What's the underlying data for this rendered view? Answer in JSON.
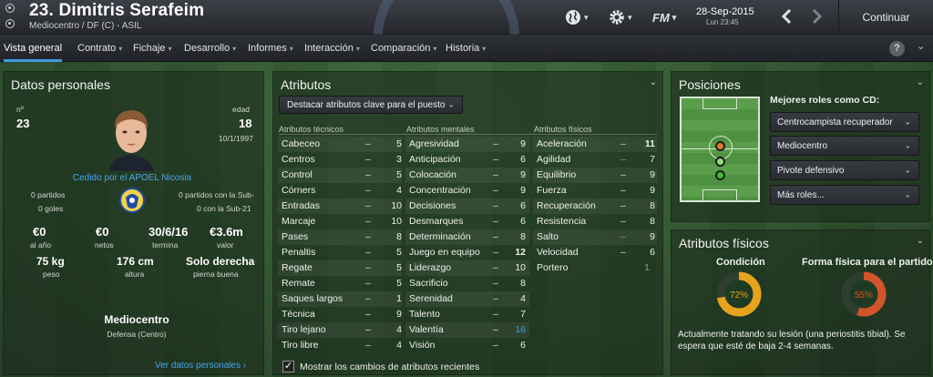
{
  "header": {
    "player_title": "23. Dimitris Serafeim",
    "subtitle": "Mediocentro / DF (C) - ASIL",
    "date": "28-Sep-2015",
    "time": "Lun 23:45",
    "fm_label": "FM",
    "continue_label": "Continuar"
  },
  "nav": {
    "items": [
      {
        "label": "Vista general",
        "chev": ""
      },
      {
        "label": "Contrato",
        "chev": "▾"
      },
      {
        "label": "Fichaje",
        "chev": "▾"
      },
      {
        "label": "Desarrollo",
        "chev": "▾"
      },
      {
        "label": "Informes",
        "chev": "▾"
      },
      {
        "label": "Interacción",
        "chev": "▾"
      },
      {
        "label": "Comparación",
        "chev": "▾"
      },
      {
        "label": "Historia",
        "chev": "▾"
      }
    ],
    "help": "?"
  },
  "personal": {
    "title": "Datos personales",
    "number_label": "nº",
    "number": "23",
    "age_label": "edad",
    "age": "18",
    "dob": "10/1/1997",
    "loan_text": "Cedido por el APOEL Nicosia",
    "matches_left": "0 partidos",
    "goals_left": "0 goles",
    "matches_right": "0 partidos con la Sub-",
    "goals_right": "0 con la Sub-21",
    "wage": "€0",
    "wage_label": "al año",
    "net": "€0",
    "net_label": "netos",
    "contract_end": "30/6/16",
    "contract_label": "termina",
    "value": "€3.6m",
    "value_label": "valor",
    "weight": "75 kg",
    "weight_label": "peso",
    "height": "176 cm",
    "height_label": "altura",
    "foot": "Solo derecha",
    "foot_label": "pierna buena",
    "position": "Mediocentro",
    "position_detail": "Defensa (Centro)",
    "more_link": "Ver datos personales ›"
  },
  "attributes": {
    "title": "Atributos",
    "highlight_dropdown": "Destacar atributos clave para el puesto",
    "technical_header": "Atributos técnicos",
    "mental_header": "Atributos mentales",
    "physical_header": "Atributos físicos",
    "technical": [
      {
        "name": "Cabeceo",
        "dash": "–",
        "value": "5"
      },
      {
        "name": "Centros",
        "dash": "–",
        "value": "3"
      },
      {
        "name": "Control",
        "dash": "–",
        "value": "5"
      },
      {
        "name": "Córners",
        "dash": "–",
        "value": "4"
      },
      {
        "name": "Entradas",
        "dash": "–",
        "value": "10"
      },
      {
        "name": "Marcaje",
        "dash": "–",
        "value": "10"
      },
      {
        "name": "Pases",
        "dash": "–",
        "value": "8"
      },
      {
        "name": "Penaltis",
        "dash": "–",
        "value": "5"
      },
      {
        "name": "Regate",
        "dash": "–",
        "value": "5"
      },
      {
        "name": "Remate",
        "dash": "–",
        "value": "5"
      },
      {
        "name": "Saques largos",
        "dash": "–",
        "value": "1"
      },
      {
        "name": "Técnica",
        "dash": "–",
        "value": "9"
      },
      {
        "name": "Tiro lejano",
        "dash": "–",
        "value": "4"
      },
      {
        "name": "Tiro libre",
        "dash": "–",
        "value": "4"
      }
    ],
    "mental": [
      {
        "name": "Agresividad",
        "dash": "–",
        "value": "9"
      },
      {
        "name": "Anticipación",
        "dash": "–",
        "value": "6"
      },
      {
        "name": "Colocación",
        "dash": "–",
        "value": "9"
      },
      {
        "name": "Concentración",
        "dash": "–",
        "value": "9"
      },
      {
        "name": "Decisiones",
        "dash": "–",
        "value": "6"
      },
      {
        "name": "Desmarques",
        "dash": "–",
        "value": "6"
      },
      {
        "name": "Determinación",
        "dash": "–",
        "value": "8"
      },
      {
        "name": "Juego en equipo",
        "dash": "–",
        "value": "12"
      },
      {
        "name": "Liderazgo",
        "dash": "–",
        "value": "10"
      },
      {
        "name": "Sacrificio",
        "dash": "–",
        "value": "8"
      },
      {
        "name": "Serenidad",
        "dash": "–",
        "value": "4"
      },
      {
        "name": "Talento",
        "dash": "–",
        "value": "7"
      },
      {
        "name": "Valentía",
        "dash": "–",
        "value": "16"
      },
      {
        "name": "Visión",
        "dash": "–",
        "value": "6"
      }
    ],
    "physical": [
      {
        "name": "Aceleración",
        "dash": "–",
        "value": "11"
      },
      {
        "name": "Agilidad",
        "dash": "–",
        "value": "7"
      },
      {
        "name": "Equilibrio",
        "dash": "–",
        "value": "9"
      },
      {
        "name": "Fuerza",
        "dash": "–",
        "value": "9"
      },
      {
        "name": "Recuperación",
        "dash": "–",
        "value": "8"
      },
      {
        "name": "Resistencia",
        "dash": "–",
        "value": "8"
      },
      {
        "name": "Salto",
        "dash": "–",
        "value": "9"
      },
      {
        "name": "Velocidad",
        "dash": "–",
        "value": "6"
      }
    ],
    "goalkeeper": {
      "name": "Portero",
      "value": "1"
    },
    "show_changes": "Mostrar los cambios de atributos recientes",
    "show_changes_checked": "✓"
  },
  "positions": {
    "title": "Posiciones",
    "best_roles_label": "Mejores roles como CD:",
    "roles": [
      "Centrocampista recuperador",
      "Mediocentro",
      "Pivote defensivo",
      "Más roles..."
    ]
  },
  "physical_panel": {
    "title": "Atributos físicos",
    "condition_label": "Condición",
    "condition_value": "72%",
    "condition_fraction": 0.72,
    "fitness_label": "Forma física para el partido",
    "fitness_value": "55%",
    "fitness_fraction": 0.55,
    "injury_text_1": "Actualmente tratando su lesión (una periostitis tibial). Se",
    "injury_text_2": "espera que esté de baja 2-4 semanas."
  },
  "colors": {
    "accent_blue": "#3f9ae0",
    "condition_ring": "#e7a21d",
    "fitness_ring": "#d2542a",
    "highlight_orange": "#e07b20"
  }
}
